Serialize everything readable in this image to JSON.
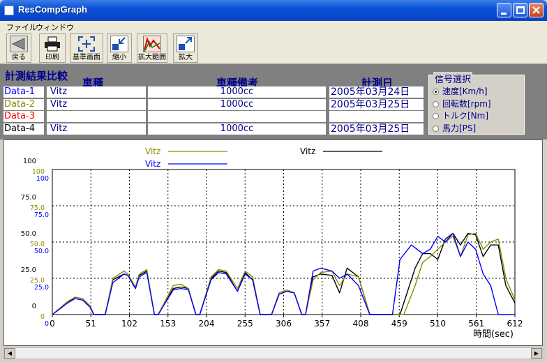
{
  "window": {
    "title": "ResCompGraph"
  },
  "menu": {
    "file": "ファイル",
    "window": "ウィンドウ"
  },
  "toolbar": {
    "back": "戻る",
    "print": "印刷",
    "base": "基準画面",
    "shrink": "縮小",
    "zoom_range": "拡大範囲",
    "zoom": "拡大"
  },
  "header": {
    "title": "計測結果比較",
    "col_model": "車種",
    "col_note": "車種備考",
    "col_date": "計測日"
  },
  "rows": [
    {
      "label": "Data-1",
      "model": "Vitz",
      "note": "1000cc",
      "date": "2005年03月24日",
      "color": "#0000ff"
    },
    {
      "label": "Data-2",
      "model": "Vitz",
      "note": "1000cc",
      "date": "2005年03月25日",
      "color": "#8b8b00"
    },
    {
      "label": "Data-3",
      "model": "",
      "note": "",
      "date": "",
      "color": "#ff0000"
    },
    {
      "label": "Data-4",
      "model": "Vitz",
      "note": "1000cc",
      "date": "2005年03月25日",
      "color": "#000000"
    }
  ],
  "signal": {
    "title": "信号選択",
    "options": [
      "速度[Km/h]",
      "回転数[rpm]",
      "トルク[Nm]",
      "馬力[PS]"
    ],
    "selected": 0
  },
  "chart_data": {
    "type": "line",
    "xlabel": "時間(sec)",
    "xlim": [
      0,
      612
    ],
    "x_ticks": [
      "0",
      "51",
      "102",
      "153",
      "204",
      "255",
      "306",
      "357",
      "408",
      "459",
      "510",
      "561",
      "612"
    ],
    "ylim": [
      0,
      100
    ],
    "y_axes": [
      {
        "color": "#000000",
        "ticks": [
          "100",
          "75.0",
          "50.0",
          "25.0",
          "0"
        ]
      },
      {
        "color": "#8b8b00",
        "ticks": [
          "100",
          "75.0",
          "50.0",
          "25.0",
          "0"
        ]
      },
      {
        "color": "#0000ff",
        "ticks": [
          "100",
          "75.0",
          "50.0",
          "25.0",
          "0"
        ]
      }
    ],
    "legend": [
      {
        "name": "Vitz",
        "color": "#8b8b00"
      },
      {
        "name": "Vitz",
        "color": "#0000ff"
      },
      {
        "name": "Vitz",
        "color": "#000000"
      }
    ],
    "series": [
      {
        "color": "#000000",
        "x": [
          0,
          20,
          30,
          40,
          50,
          55,
          70,
          80,
          95,
          100,
          110,
          115,
          125,
          135,
          140,
          160,
          170,
          180,
          190,
          195,
          210,
          220,
          230,
          245,
          255,
          265,
          275,
          280,
          290,
          300,
          310,
          320,
          330,
          335,
          345,
          355,
          370,
          380,
          390,
          405,
          420,
          450,
          460,
          480,
          490,
          500,
          510,
          520,
          530,
          540,
          550,
          560,
          570,
          580,
          590,
          600,
          612
        ],
        "y": [
          0,
          8,
          12,
          11,
          5,
          0,
          0,
          24,
          28,
          27,
          18,
          27,
          30,
          0,
          0,
          18,
          19,
          18,
          0,
          0,
          25,
          30,
          29,
          16,
          29,
          24,
          0,
          0,
          0,
          14,
          16,
          15,
          0,
          0,
          26,
          28,
          27,
          15,
          32,
          26,
          0,
          0,
          0,
          32,
          42,
          42,
          38,
          52,
          56,
          48,
          56,
          55,
          40,
          48,
          48,
          20,
          8
        ]
      },
      {
        "color": "#8b8b00",
        "x": [
          0,
          20,
          30,
          40,
          50,
          55,
          70,
          80,
          95,
          100,
          110,
          115,
          125,
          135,
          140,
          160,
          170,
          180,
          190,
          195,
          210,
          220,
          230,
          245,
          255,
          265,
          275,
          280,
          290,
          300,
          310,
          320,
          330,
          335,
          345,
          355,
          370,
          380,
          390,
          405,
          420,
          455,
          465,
          480,
          490,
          500,
          510,
          520,
          530,
          540,
          550,
          560,
          570,
          580,
          590,
          600,
          612
        ],
        "y": [
          0,
          9,
          12,
          11,
          6,
          0,
          0,
          25,
          30,
          28,
          19,
          28,
          31,
          0,
          0,
          20,
          21,
          18,
          0,
          0,
          26,
          31,
          30,
          18,
          30,
          26,
          0,
          0,
          0,
          15,
          17,
          15,
          0,
          0,
          24,
          29,
          30,
          20,
          28,
          26,
          0,
          0,
          0,
          20,
          36,
          40,
          45,
          50,
          54,
          40,
          55,
          56,
          45,
          50,
          52,
          25,
          10
        ]
      },
      {
        "color": "#0000ff",
        "x": [
          0,
          20,
          30,
          40,
          50,
          55,
          70,
          80,
          95,
          100,
          110,
          115,
          125,
          135,
          140,
          160,
          170,
          180,
          190,
          195,
          210,
          220,
          230,
          245,
          255,
          265,
          275,
          280,
          290,
          300,
          310,
          320,
          330,
          335,
          345,
          355,
          370,
          380,
          390,
          405,
          420,
          450,
          460,
          475,
          490,
          500,
          510,
          520,
          530,
          540,
          550,
          560,
          570,
          580,
          590,
          600,
          612
        ],
        "y": [
          0,
          8,
          11,
          10,
          5,
          0,
          0,
          22,
          28,
          27,
          18,
          26,
          29,
          0,
          0,
          17,
          18,
          17,
          0,
          0,
          24,
          29,
          28,
          16,
          28,
          24,
          0,
          0,
          0,
          14,
          16,
          15,
          0,
          0,
          30,
          32,
          30,
          25,
          28,
          20,
          0,
          0,
          38,
          48,
          42,
          45,
          54,
          50,
          56,
          40,
          50,
          45,
          28,
          20,
          0,
          0,
          0
        ]
      }
    ]
  }
}
